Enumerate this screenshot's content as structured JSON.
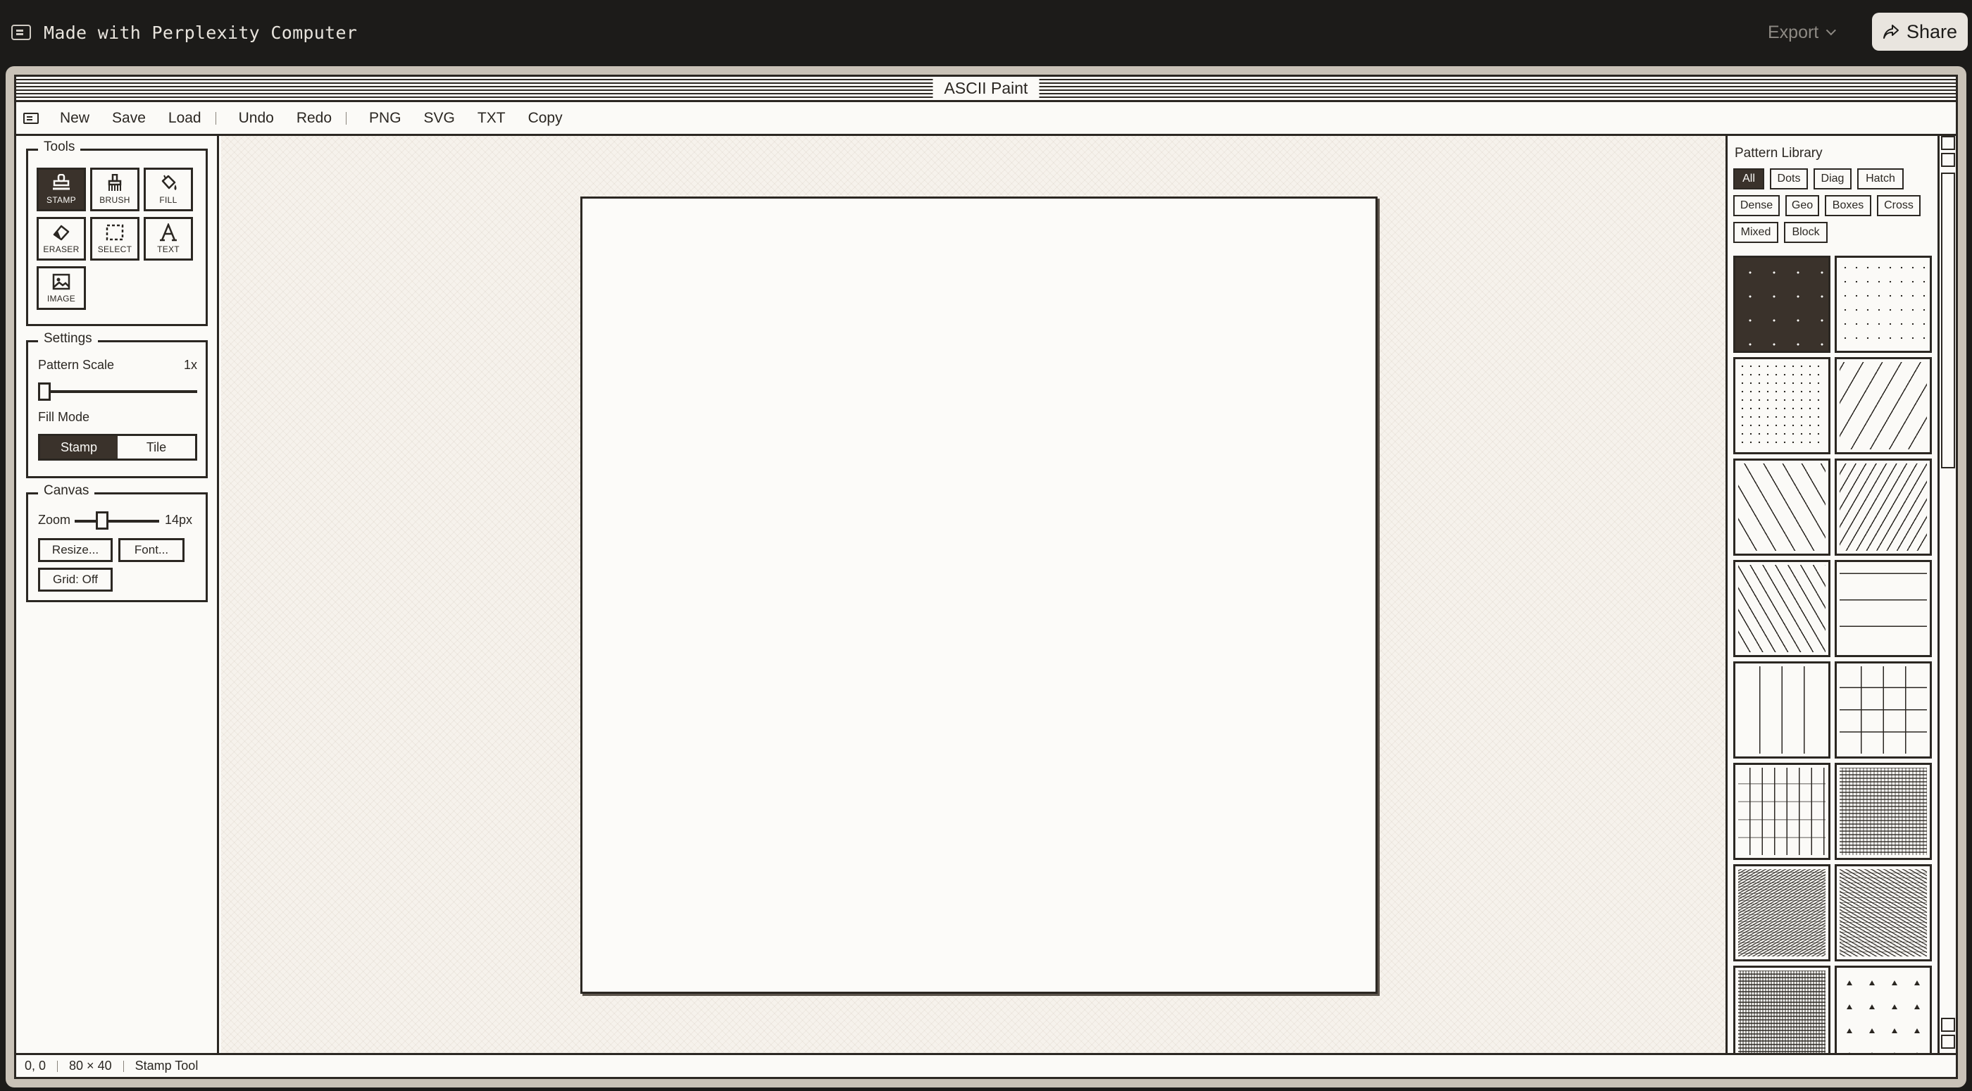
{
  "host": {
    "title": "Made with Perplexity Computer",
    "export_label": "Export",
    "share_label": "Share"
  },
  "app": {
    "title": "ASCII Paint",
    "menu": {
      "file": [
        "New",
        "Save",
        "Load"
      ],
      "edit": [
        "Undo",
        "Redo"
      ],
      "export": [
        "PNG",
        "SVG",
        "TXT",
        "Copy"
      ]
    }
  },
  "tools": {
    "legend": "Tools",
    "items": [
      {
        "label": "STAMP",
        "icon": "stamp-icon",
        "active": true
      },
      {
        "label": "BRUSH",
        "icon": "brush-icon",
        "active": false
      },
      {
        "label": "FILL",
        "icon": "fill-bucket-icon",
        "active": false
      },
      {
        "label": "ERASER",
        "icon": "eraser-icon",
        "active": false
      },
      {
        "label": "SELECT",
        "icon": "select-marquee-icon",
        "active": false
      },
      {
        "label": "TEXT",
        "icon": "text-icon",
        "active": false
      },
      {
        "label": "IMAGE",
        "icon": "image-icon",
        "active": false
      }
    ]
  },
  "settings": {
    "legend": "Settings",
    "pattern_scale_label": "Pattern Scale",
    "pattern_scale_value": "1x",
    "pattern_scale_fraction": 0.0,
    "fill_mode_label": "Fill Mode",
    "fill_mode_options": [
      "Stamp",
      "Tile"
    ],
    "fill_mode_selected": "Stamp"
  },
  "canvas": {
    "legend": "Canvas",
    "zoom_label": "Zoom",
    "zoom_value": "14px",
    "zoom_fraction": 0.3,
    "resize_label": "Resize...",
    "font_label": "Font...",
    "grid_label": "Grid: Off"
  },
  "library": {
    "title": "Pattern Library",
    "filters": [
      "All",
      "Dots",
      "Diag",
      "Hatch",
      "Dense",
      "Geo",
      "Boxes",
      "Cross",
      "Mixed",
      "Block"
    ],
    "selected_filter": "All",
    "tiles": [
      {
        "name": "pattern-sparse-dots-dark",
        "selected": true
      },
      {
        "name": "pattern-sparse-dots",
        "selected": false
      },
      {
        "name": "pattern-dense-dots",
        "selected": false
      },
      {
        "name": "pattern-diagonal-forward",
        "selected": false
      },
      {
        "name": "pattern-diagonal-back",
        "selected": false
      },
      {
        "name": "pattern-diagonal-dense",
        "selected": false
      },
      {
        "name": "pattern-diagonal-back-dense",
        "selected": false
      },
      {
        "name": "pattern-horizontal-lines",
        "selected": false
      },
      {
        "name": "pattern-vertical-lines",
        "selected": false
      },
      {
        "name": "pattern-grid",
        "selected": false
      },
      {
        "name": "pattern-cross-dashes",
        "selected": false
      },
      {
        "name": "pattern-hash-fill",
        "selected": false
      },
      {
        "name": "pattern-wave-dense",
        "selected": false
      },
      {
        "name": "pattern-diag-dense-block",
        "selected": false
      },
      {
        "name": "pattern-mixed-chars",
        "selected": false
      },
      {
        "name": "pattern-triangles",
        "selected": false
      }
    ]
  },
  "status": {
    "cursor": "0, 0",
    "size": "80 × 40",
    "tool": "Stamp Tool"
  }
}
